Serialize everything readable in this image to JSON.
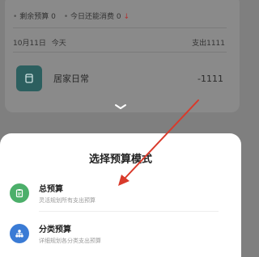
{
  "background": {
    "budget_remaining_label": "剩余预算",
    "budget_remaining_value": "0",
    "today_spendable_label": "今日还能消费",
    "today_spendable_value": "0",
    "date_label": "10月11日",
    "day_label": "今天",
    "expense_summary": "支出1111",
    "entry": {
      "name": "居家日常",
      "amount": "-1111",
      "icon": "cup-icon"
    }
  },
  "sheet": {
    "title": "选择预算模式",
    "options": [
      {
        "title": "总预算",
        "subtitle": "灵活规划所有支出预算",
        "icon": "clipboard-icon",
        "color": "#4caf6a"
      },
      {
        "title": "分类预算",
        "subtitle": "详细规划各分类支出预算",
        "icon": "category-tree-icon",
        "color": "#3a7bd5"
      }
    ]
  },
  "annotation": {
    "arrow_color": "#d93a2b"
  }
}
